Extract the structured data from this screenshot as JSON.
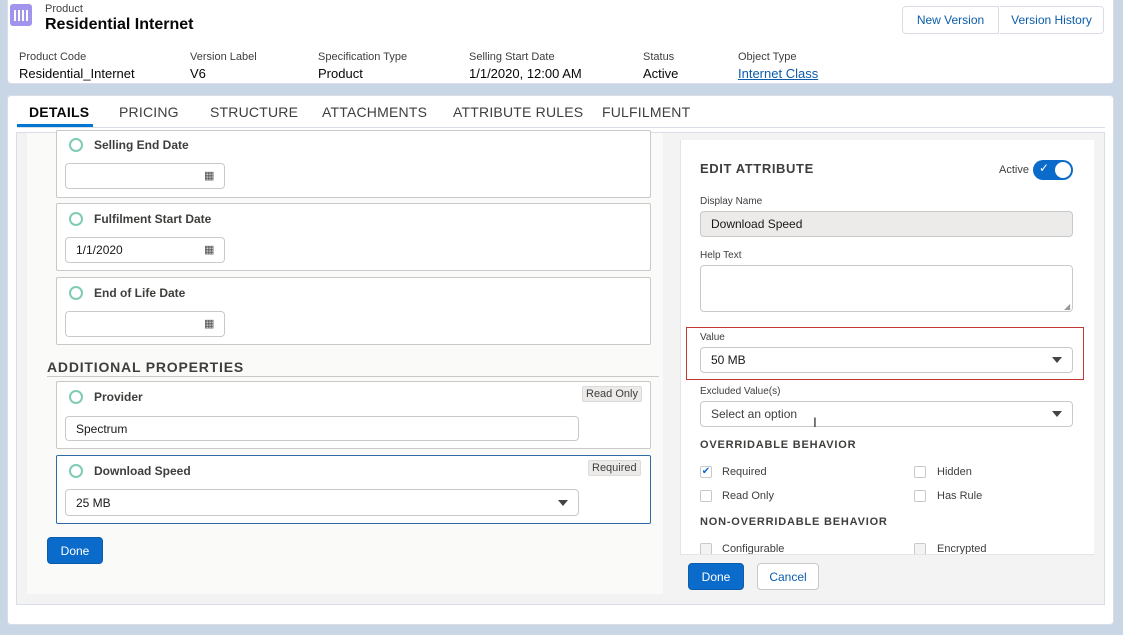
{
  "header": {
    "object_label": "Product",
    "title": "Residential Internet",
    "buttons": {
      "new_version": "New Version",
      "version_history": "Version History"
    },
    "fields": [
      {
        "label": "Product Code",
        "value": "Residential_Internet"
      },
      {
        "label": "Version Label",
        "value": "V6"
      },
      {
        "label": "Specification Type",
        "value": "Product"
      },
      {
        "label": "Selling Start Date",
        "value": "1/1/2020, 12:00 AM"
      },
      {
        "label": "Status",
        "value": "Active"
      },
      {
        "label": "Object Type",
        "value": "Internet Class"
      }
    ]
  },
  "tabs": [
    "DETAILS",
    "PRICING",
    "STRUCTURE",
    "ATTACHMENTS",
    "ATTRIBUTE RULES",
    "FULFILMENT"
  ],
  "left": {
    "date_fields": [
      {
        "label": "Selling End Date",
        "value": ""
      },
      {
        "label": "Fulfilment Start Date",
        "value": "1/1/2020"
      },
      {
        "label": "End of Life Date",
        "value": ""
      }
    ],
    "additional_title": "ADDITIONAL PROPERTIES",
    "provider": {
      "label": "Provider",
      "badge": "Read Only",
      "value": "Spectrum"
    },
    "download_speed": {
      "label": "Download Speed",
      "badge": "Required",
      "value": "25 MB"
    },
    "done_label": "Done"
  },
  "right": {
    "title": "EDIT ATTRIBUTE",
    "active_label": "Active",
    "display_name_label": "Display Name",
    "display_name_value": "Download Speed",
    "help_text_label": "Help Text",
    "value_label": "Value",
    "value_selected": "50 MB",
    "excluded_label": "Excluded Value(s)",
    "excluded_placeholder": "Select an option",
    "overridable_title": "OVERRIDABLE BEHAVIOR",
    "overridable": [
      {
        "label": "Required",
        "checked": true
      },
      {
        "label": "Hidden",
        "checked": false
      },
      {
        "label": "Read Only",
        "checked": false
      },
      {
        "label": "Has Rule",
        "checked": false
      }
    ],
    "non_overridable_title": "NON-OVERRIDABLE BEHAVIOR",
    "non_overridable": [
      {
        "label": "Configurable"
      },
      {
        "label": "Encrypted"
      }
    ],
    "done_label": "Done",
    "cancel_label": "Cancel"
  },
  "colors": {
    "accent": "#0b6bcb",
    "highlight": "#c23934",
    "radio": "#7fcbb6",
    "brand_icon": "#a094ed"
  }
}
